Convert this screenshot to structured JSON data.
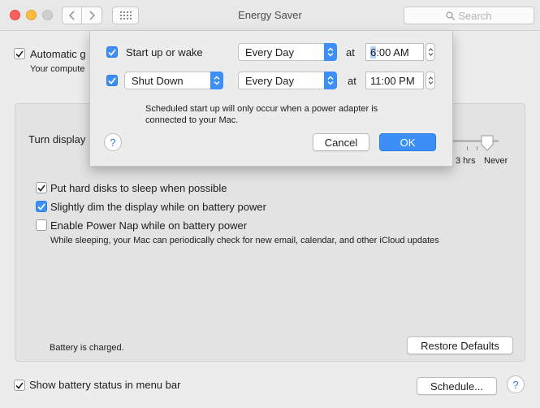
{
  "window": {
    "title": "Energy Saver"
  },
  "search": {
    "placeholder": "Search"
  },
  "main": {
    "auto_checkbox_label": "Automatic g",
    "auto_desc": "Your compute",
    "turn_display_label": "Turn display",
    "slider_labels": [
      "3 hrs",
      "Never"
    ],
    "options": [
      {
        "label": "Put hard disks to sleep when possible",
        "checked": true
      },
      {
        "label": "Slightly dim the display while on battery power",
        "checked": true
      },
      {
        "label": "Enable Power Nap while on battery power",
        "checked": false
      }
    ],
    "power_nap_desc": "While sleeping, your Mac can periodically check for new email, calendar, and other iCloud updates",
    "battery_status": "Battery is charged.",
    "restore_defaults": "Restore Defaults",
    "show_battery_label": "Show battery status in menu bar",
    "schedule_button": "Schedule..."
  },
  "sheet": {
    "row1": {
      "checked": true,
      "event_label": "Start up or wake",
      "day": "Every Day",
      "at": "at",
      "time_hour": "6",
      "time_rest": ":00 AM"
    },
    "row2": {
      "checked": true,
      "event": "Shut Down",
      "day": "Every Day",
      "at": "at",
      "time": "11:00 PM"
    },
    "note_line1": "Scheduled start up will only occur when a power adapter is",
    "note_line2": "connected to your Mac.",
    "help": "?",
    "cancel": "Cancel",
    "ok": "OK"
  },
  "colors": {
    "accent": "#3d8ef7"
  }
}
